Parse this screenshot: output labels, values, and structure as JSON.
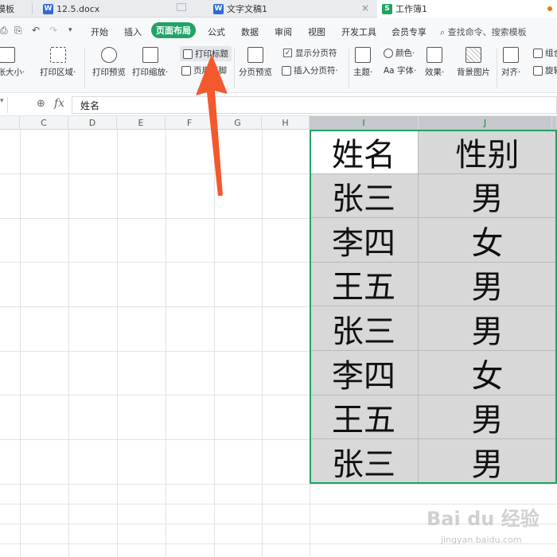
{
  "tabs": [
    {
      "label": "模板"
    },
    {
      "label": "12.5.docx"
    },
    {
      "label": "文字文稿1"
    },
    {
      "label": "工作簿1"
    }
  ],
  "menu": {
    "items": [
      "开始",
      "插入",
      "页面布局",
      "公式",
      "数据",
      "审阅",
      "视图",
      "开发工具",
      "会员专享"
    ],
    "active": "页面布局",
    "search_placeholder": "查找命令、搜索模板"
  },
  "toolbar": {
    "paper_size": "纸张大小·",
    "print_area": "打印区域·",
    "print_preview": "打印预览",
    "print_scale": "打印缩放·",
    "print_titles": "打印标题",
    "header_footer": "页眉页脚",
    "page_break_preview": "分页预览",
    "show_page_breaks": "显示分页符",
    "insert_page_break": "插入分页符·",
    "theme": "主题·",
    "color": "颜色·",
    "font": "Aa 字体·",
    "effects": "效果·",
    "background": "背景图片",
    "align": "对齐·",
    "group": "组合",
    "rotate": "旋转"
  },
  "formula_bar": {
    "fx": "fx",
    "value": "姓名"
  },
  "columns": [
    "C",
    "D",
    "E",
    "F",
    "G",
    "H",
    "I",
    "J"
  ],
  "selected_columns": [
    "I",
    "J"
  ],
  "table": {
    "header": [
      "姓名",
      "性别"
    ],
    "rows": [
      [
        "张三",
        "男"
      ],
      [
        "李四",
        "女"
      ],
      [
        "王五",
        "男"
      ],
      [
        "张三",
        "男"
      ],
      [
        "李四",
        "女"
      ],
      [
        "王五",
        "男"
      ],
      [
        "张三",
        "男"
      ]
    ]
  },
  "watermark": {
    "main": "Bai du 经验",
    "sub": "jingyan.baidu.com"
  },
  "colors": {
    "accent": "#21a366",
    "arrow": "#f2592c"
  }
}
